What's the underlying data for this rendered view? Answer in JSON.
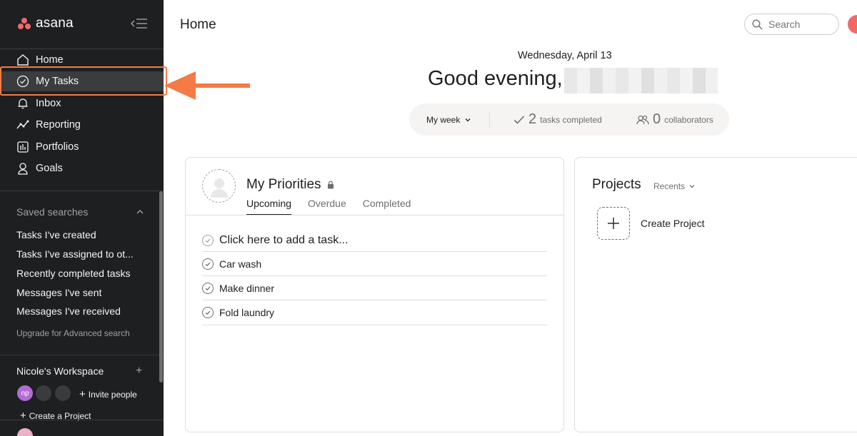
{
  "sidebar": {
    "logo_text": "asana",
    "nav": [
      {
        "label": "Home",
        "icon": "home-icon"
      },
      {
        "label": "My Tasks",
        "icon": "check-circle-icon"
      },
      {
        "label": "Inbox",
        "icon": "bell-icon"
      },
      {
        "label": "Reporting",
        "icon": "trend-line-icon"
      },
      {
        "label": "Portfolios",
        "icon": "portfolio-icon"
      },
      {
        "label": "Goals",
        "icon": "person-icon"
      }
    ],
    "saved_searches": {
      "title": "Saved searches",
      "items": [
        "Tasks I've created",
        "Tasks I've assigned to ot...",
        "Recently completed tasks",
        "Messages I've sent",
        "Messages I've received"
      ],
      "upgrade": "Upgrade for Advanced search"
    },
    "workspace": {
      "name": "Nicole's Workspace",
      "avatar_initials": "np",
      "invite": "Invite people",
      "create_project": "Create a Project"
    }
  },
  "header": {
    "title": "Home",
    "search_placeholder": "Search"
  },
  "greeting": {
    "date": "Wednesday, April 13",
    "text": "Good evening,"
  },
  "stats": {
    "period": "My week",
    "tasks_count": "2",
    "tasks_label": "tasks completed",
    "collab_count": "0",
    "collab_label": "collaborators"
  },
  "priorities": {
    "title": "My Priorities",
    "tabs": [
      "Upcoming",
      "Overdue",
      "Completed"
    ],
    "add_task": "Click here to add a task...",
    "tasks": [
      "Car wash",
      "Make dinner",
      "Fold laundry"
    ]
  },
  "projects": {
    "title": "Projects",
    "filter": "Recents",
    "create_label": "Create Project"
  },
  "colors": {
    "sidebar_bg": "#1e1f21",
    "accent": "#f06a6a",
    "highlight": "#f47b45"
  }
}
